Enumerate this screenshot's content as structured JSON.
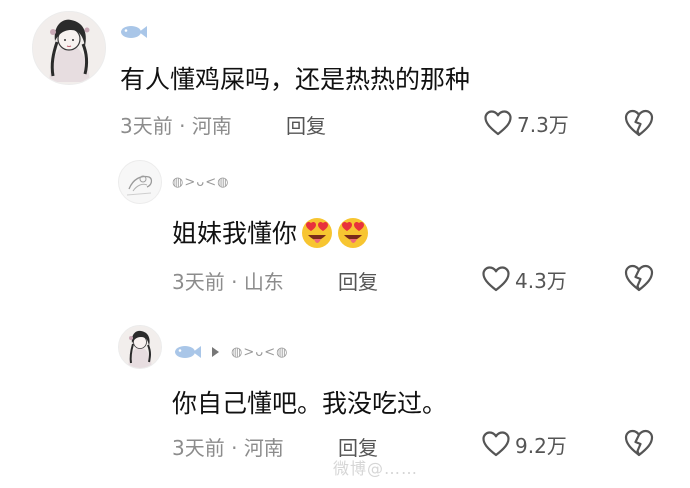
{
  "comments": [
    {
      "text": "有人懂鸡屎吗，还是热热的那种",
      "username": "",
      "time": "3天前",
      "location": "河南",
      "reply_label": "回复",
      "likes": "7.3万",
      "avatar_icon": "ink-portrait-avatar",
      "badge_icon": "fish-icon"
    },
    {
      "text": "姐妹我懂你",
      "username": "◍>ᴗ<◍",
      "time": "3天前",
      "location": "山东",
      "reply_label": "回复",
      "likes": "4.3万",
      "avatar_icon": "sketch-avatar",
      "emoji_icons": [
        "heart-eyes-tongue-emoji",
        "heart-eyes-tongue-emoji"
      ]
    },
    {
      "text": "你自己懂吧。我没吃过。",
      "username": "◍>ᴗ<◍",
      "time": "3天前",
      "location": "河南",
      "reply_label": "回复",
      "likes": "9.2万",
      "avatar_icon": "ink-portrait-avatar",
      "badge_icon": "fish-icon",
      "reply_arrow_icon": "reply-arrow-icon"
    }
  ],
  "separator": "·",
  "watermark": "微博@……",
  "colors": {
    "meta_gray": "#8c8c8c",
    "fish_blue": "#a9c6e8",
    "emoji_yellow": "#f7c531",
    "emoji_heart": "#e8323c"
  }
}
